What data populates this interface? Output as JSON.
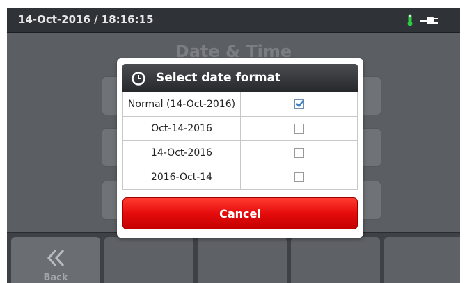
{
  "status": {
    "datetime": "14-Oct-2016 / 18:16:15"
  },
  "page": {
    "title": "Date & Time"
  },
  "nav": {
    "back_label": "Back"
  },
  "dialog": {
    "title": "Select date format",
    "options": [
      {
        "label": "Normal (14-Oct-2016)",
        "checked": true
      },
      {
        "label": "Oct-14-2016",
        "checked": false
      },
      {
        "label": "14-Oct-2016",
        "checked": false
      },
      {
        "label": "2016-Oct-14",
        "checked": false
      }
    ],
    "cancel_label": "Cancel"
  },
  "colors": {
    "accent_red": "#e50c0c",
    "thermometer_green": "#2ecc40",
    "check_blue": "#3a7fc4"
  }
}
